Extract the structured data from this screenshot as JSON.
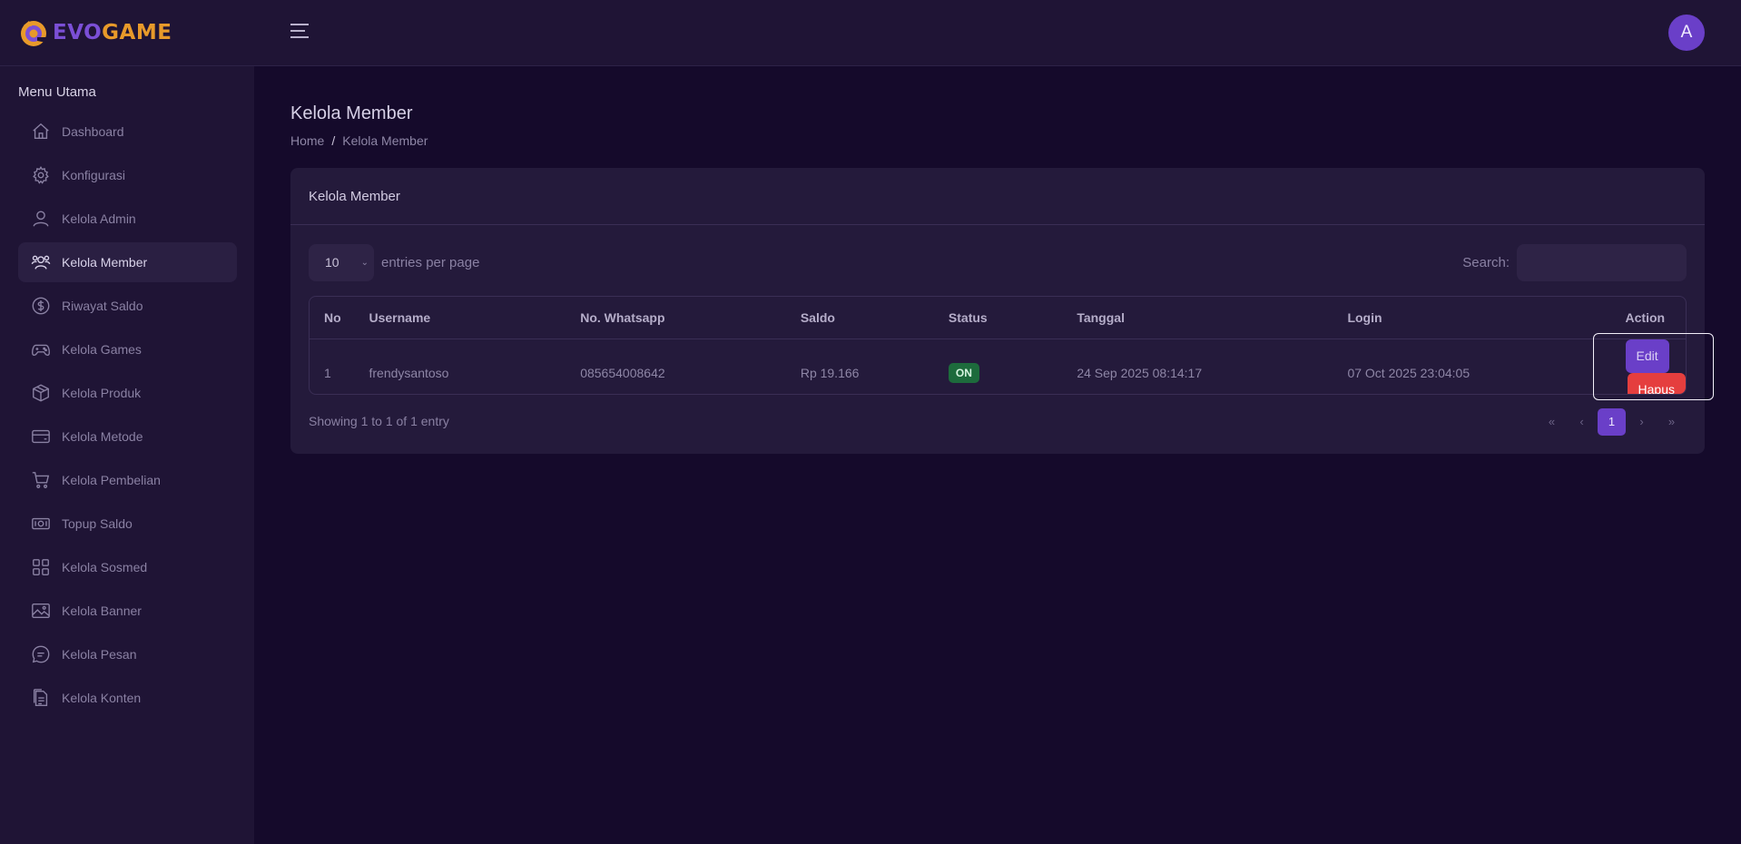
{
  "brand": {
    "part1": "EVO",
    "part2": "GAME"
  },
  "user": {
    "avatar_initial": "A"
  },
  "sidebar": {
    "title": "Menu Utama",
    "items": [
      {
        "label": "Dashboard",
        "icon": "home-icon"
      },
      {
        "label": "Konfigurasi",
        "icon": "gear-icon"
      },
      {
        "label": "Kelola Admin",
        "icon": "user-icon"
      },
      {
        "label": "Kelola Member",
        "icon": "users-icon",
        "active": true
      },
      {
        "label": "Riwayat Saldo",
        "icon": "dollar-circle-icon"
      },
      {
        "label": "Kelola Games",
        "icon": "gamepad-icon"
      },
      {
        "label": "Kelola Produk",
        "icon": "box-icon"
      },
      {
        "label": "Kelola Metode",
        "icon": "credit-card-icon"
      },
      {
        "label": "Kelola Pembelian",
        "icon": "cart-icon"
      },
      {
        "label": "Topup Saldo",
        "icon": "cash-icon"
      },
      {
        "label": "Kelola Sosmed",
        "icon": "grid-icon"
      },
      {
        "label": "Kelola Banner",
        "icon": "image-icon"
      },
      {
        "label": "Kelola Pesan",
        "icon": "chat-icon"
      },
      {
        "label": "Kelola Konten",
        "icon": "document-icon"
      }
    ]
  },
  "page": {
    "title": "Kelola Member",
    "breadcrumb": {
      "home": "Home",
      "separator": "/",
      "current": "Kelola Member"
    }
  },
  "card": {
    "title": "Kelola Member",
    "entries": {
      "value": "10",
      "label": "entries per page"
    },
    "search": {
      "label": "Search:",
      "value": ""
    },
    "table": {
      "headers": [
        "No",
        "Username",
        "No. Whatsapp",
        "Saldo",
        "Status",
        "Tanggal",
        "Login",
        "Action"
      ],
      "rows": [
        {
          "no": "1",
          "username": "frendysantoso",
          "whatsapp": "085654008642",
          "saldo": "Rp 19.166",
          "status": "ON",
          "tanggal": "24 Sep 2025 08:14:17",
          "login": "07 Oct 2025 23:04:05",
          "edit_label": "Edit",
          "delete_label": "Hapus"
        }
      ]
    },
    "info": "Showing 1 to 1 of 1 entry",
    "pagination": {
      "first": "«",
      "prev": "‹",
      "current": "1",
      "next": "›",
      "last": "»"
    }
  },
  "colors": {
    "background": "#150a2b",
    "sidebar": "#1f1435",
    "accent": "#6a3fc8",
    "danger": "#e53e3e",
    "success_badge": "#1d6b3c",
    "logo_purple": "#7b4fd6",
    "logo_orange": "#e89a2a"
  }
}
